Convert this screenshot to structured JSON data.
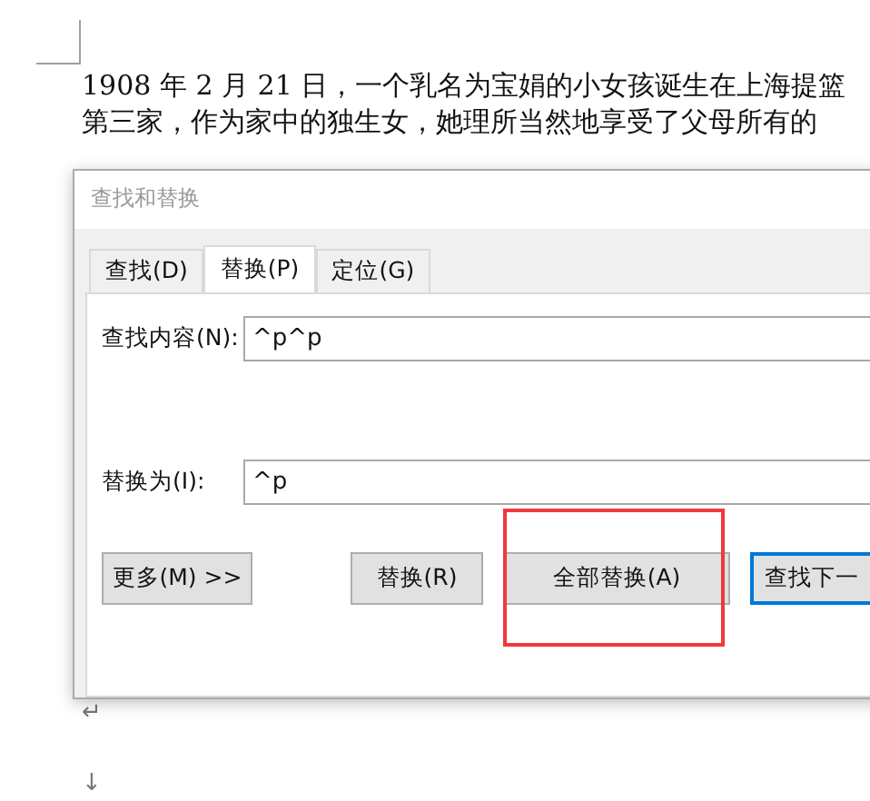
{
  "document": {
    "paragraph_lines": [
      "1908 年 2 月 21 日，一个乳名为宝娟的小女孩诞生在上海提篮",
      "第三家，作为家中的独生女，她理所当然地享受了父母所有的"
    ],
    "marks": [
      "↵",
      "↓"
    ]
  },
  "dialog": {
    "title": "查找和替换",
    "tabs": [
      {
        "label": "查找(D)",
        "selected": false
      },
      {
        "label": "替换(P)",
        "selected": true
      },
      {
        "label": "定位(G)",
        "selected": false
      }
    ],
    "fields": [
      {
        "label": "查找内容(N):",
        "value": "^p^p"
      },
      {
        "label": "替换为(I):",
        "value": "^p"
      }
    ],
    "buttons": [
      {
        "label": "更多(M) >>",
        "default": false,
        "highlighted": false
      },
      {
        "label": "替换(R)",
        "default": false,
        "highlighted": false
      },
      {
        "label": "全部替换(A)",
        "default": false,
        "highlighted": true
      },
      {
        "label": "查找下一",
        "default": true,
        "highlighted": false
      }
    ]
  }
}
